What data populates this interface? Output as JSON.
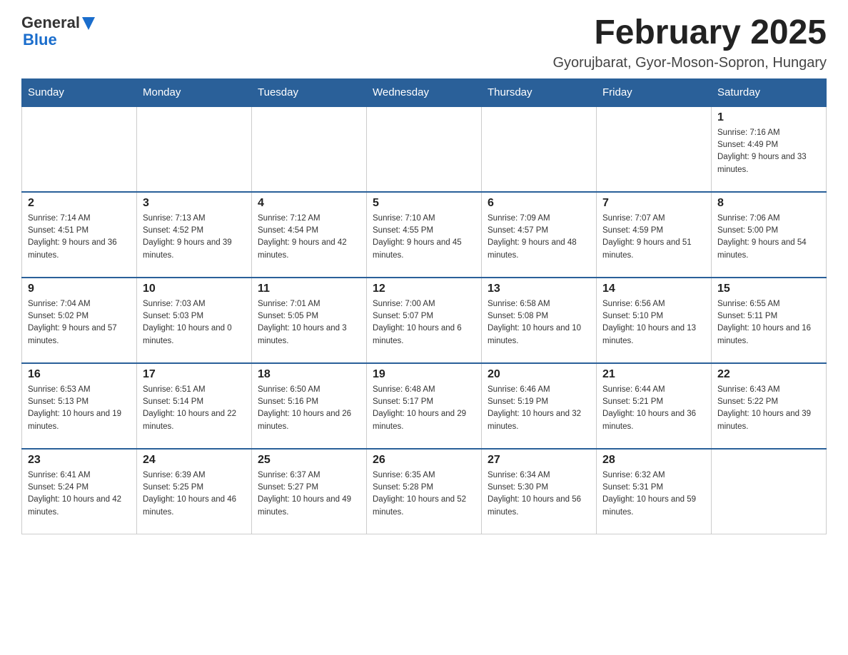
{
  "header": {
    "logo_general": "General",
    "logo_blue": "Blue",
    "month_title": "February 2025",
    "location": "Gyorujbarat, Gyor-Moson-Sopron, Hungary"
  },
  "weekdays": [
    "Sunday",
    "Monday",
    "Tuesday",
    "Wednesday",
    "Thursday",
    "Friday",
    "Saturday"
  ],
  "weeks": [
    [
      {
        "day": "",
        "sunrise": "",
        "sunset": "",
        "daylight": ""
      },
      {
        "day": "",
        "sunrise": "",
        "sunset": "",
        "daylight": ""
      },
      {
        "day": "",
        "sunrise": "",
        "sunset": "",
        "daylight": ""
      },
      {
        "day": "",
        "sunrise": "",
        "sunset": "",
        "daylight": ""
      },
      {
        "day": "",
        "sunrise": "",
        "sunset": "",
        "daylight": ""
      },
      {
        "day": "",
        "sunrise": "",
        "sunset": "",
        "daylight": ""
      },
      {
        "day": "1",
        "sunrise": "Sunrise: 7:16 AM",
        "sunset": "Sunset: 4:49 PM",
        "daylight": "Daylight: 9 hours and 33 minutes."
      }
    ],
    [
      {
        "day": "2",
        "sunrise": "Sunrise: 7:14 AM",
        "sunset": "Sunset: 4:51 PM",
        "daylight": "Daylight: 9 hours and 36 minutes."
      },
      {
        "day": "3",
        "sunrise": "Sunrise: 7:13 AM",
        "sunset": "Sunset: 4:52 PM",
        "daylight": "Daylight: 9 hours and 39 minutes."
      },
      {
        "day": "4",
        "sunrise": "Sunrise: 7:12 AM",
        "sunset": "Sunset: 4:54 PM",
        "daylight": "Daylight: 9 hours and 42 minutes."
      },
      {
        "day": "5",
        "sunrise": "Sunrise: 7:10 AM",
        "sunset": "Sunset: 4:55 PM",
        "daylight": "Daylight: 9 hours and 45 minutes."
      },
      {
        "day": "6",
        "sunrise": "Sunrise: 7:09 AM",
        "sunset": "Sunset: 4:57 PM",
        "daylight": "Daylight: 9 hours and 48 minutes."
      },
      {
        "day": "7",
        "sunrise": "Sunrise: 7:07 AM",
        "sunset": "Sunset: 4:59 PM",
        "daylight": "Daylight: 9 hours and 51 minutes."
      },
      {
        "day": "8",
        "sunrise": "Sunrise: 7:06 AM",
        "sunset": "Sunset: 5:00 PM",
        "daylight": "Daylight: 9 hours and 54 minutes."
      }
    ],
    [
      {
        "day": "9",
        "sunrise": "Sunrise: 7:04 AM",
        "sunset": "Sunset: 5:02 PM",
        "daylight": "Daylight: 9 hours and 57 minutes."
      },
      {
        "day": "10",
        "sunrise": "Sunrise: 7:03 AM",
        "sunset": "Sunset: 5:03 PM",
        "daylight": "Daylight: 10 hours and 0 minutes."
      },
      {
        "day": "11",
        "sunrise": "Sunrise: 7:01 AM",
        "sunset": "Sunset: 5:05 PM",
        "daylight": "Daylight: 10 hours and 3 minutes."
      },
      {
        "day": "12",
        "sunrise": "Sunrise: 7:00 AM",
        "sunset": "Sunset: 5:07 PM",
        "daylight": "Daylight: 10 hours and 6 minutes."
      },
      {
        "day": "13",
        "sunrise": "Sunrise: 6:58 AM",
        "sunset": "Sunset: 5:08 PM",
        "daylight": "Daylight: 10 hours and 10 minutes."
      },
      {
        "day": "14",
        "sunrise": "Sunrise: 6:56 AM",
        "sunset": "Sunset: 5:10 PM",
        "daylight": "Daylight: 10 hours and 13 minutes."
      },
      {
        "day": "15",
        "sunrise": "Sunrise: 6:55 AM",
        "sunset": "Sunset: 5:11 PM",
        "daylight": "Daylight: 10 hours and 16 minutes."
      }
    ],
    [
      {
        "day": "16",
        "sunrise": "Sunrise: 6:53 AM",
        "sunset": "Sunset: 5:13 PM",
        "daylight": "Daylight: 10 hours and 19 minutes."
      },
      {
        "day": "17",
        "sunrise": "Sunrise: 6:51 AM",
        "sunset": "Sunset: 5:14 PM",
        "daylight": "Daylight: 10 hours and 22 minutes."
      },
      {
        "day": "18",
        "sunrise": "Sunrise: 6:50 AM",
        "sunset": "Sunset: 5:16 PM",
        "daylight": "Daylight: 10 hours and 26 minutes."
      },
      {
        "day": "19",
        "sunrise": "Sunrise: 6:48 AM",
        "sunset": "Sunset: 5:17 PM",
        "daylight": "Daylight: 10 hours and 29 minutes."
      },
      {
        "day": "20",
        "sunrise": "Sunrise: 6:46 AM",
        "sunset": "Sunset: 5:19 PM",
        "daylight": "Daylight: 10 hours and 32 minutes."
      },
      {
        "day": "21",
        "sunrise": "Sunrise: 6:44 AM",
        "sunset": "Sunset: 5:21 PM",
        "daylight": "Daylight: 10 hours and 36 minutes."
      },
      {
        "day": "22",
        "sunrise": "Sunrise: 6:43 AM",
        "sunset": "Sunset: 5:22 PM",
        "daylight": "Daylight: 10 hours and 39 minutes."
      }
    ],
    [
      {
        "day": "23",
        "sunrise": "Sunrise: 6:41 AM",
        "sunset": "Sunset: 5:24 PM",
        "daylight": "Daylight: 10 hours and 42 minutes."
      },
      {
        "day": "24",
        "sunrise": "Sunrise: 6:39 AM",
        "sunset": "Sunset: 5:25 PM",
        "daylight": "Daylight: 10 hours and 46 minutes."
      },
      {
        "day": "25",
        "sunrise": "Sunrise: 6:37 AM",
        "sunset": "Sunset: 5:27 PM",
        "daylight": "Daylight: 10 hours and 49 minutes."
      },
      {
        "day": "26",
        "sunrise": "Sunrise: 6:35 AM",
        "sunset": "Sunset: 5:28 PM",
        "daylight": "Daylight: 10 hours and 52 minutes."
      },
      {
        "day": "27",
        "sunrise": "Sunrise: 6:34 AM",
        "sunset": "Sunset: 5:30 PM",
        "daylight": "Daylight: 10 hours and 56 minutes."
      },
      {
        "day": "28",
        "sunrise": "Sunrise: 6:32 AM",
        "sunset": "Sunset: 5:31 PM",
        "daylight": "Daylight: 10 hours and 59 minutes."
      },
      {
        "day": "",
        "sunrise": "",
        "sunset": "",
        "daylight": ""
      }
    ]
  ]
}
